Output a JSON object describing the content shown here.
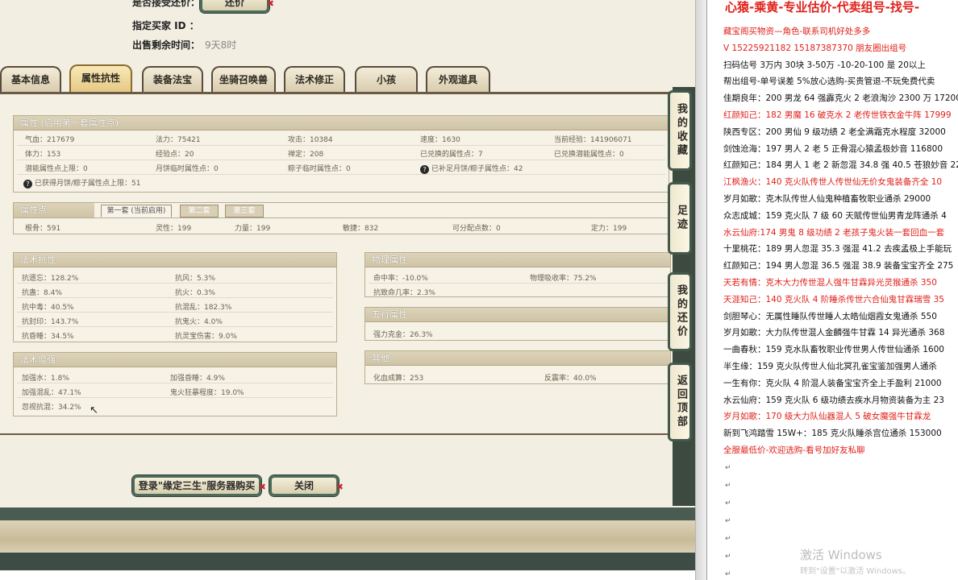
{
  "game": {
    "top": {
      "counter_offer_label": "是否接受还价：",
      "counter_offer_btn": "还价",
      "buyer_id_label": "指定买家 ID ：",
      "time_left_label": "出售剩余时间：",
      "time_left_value": "9天8时"
    },
    "tabs": [
      {
        "label": "基本信息"
      },
      {
        "label": "属性抗性"
      },
      {
        "label": "装备法宝"
      },
      {
        "label": "坐骑召唤兽"
      },
      {
        "label": "法术修正"
      },
      {
        "label": "小孩"
      },
      {
        "label": "外观道具"
      }
    ],
    "attr_panel": {
      "title": "属性 (启用第一套属性点)",
      "rows": [
        [
          "气血：217679",
          "法力：75421",
          "攻击：10384",
          "速度：1630",
          "当前经验：141906071"
        ],
        [
          "体力：153",
          "经验点：20",
          "禅定：208",
          "已兑换的属性点：7",
          "已兑换潜能属性点：0"
        ],
        [
          "潜能属性点上限：0",
          "月饼临时属性点：0",
          "粽子临时属性点：0",
          "已补足月饼/粽子属性点：42",
          ""
        ],
        [
          "已获得月饼/粽子属性点上限：51",
          "",
          "",
          "",
          ""
        ]
      ]
    },
    "points_panel": {
      "title": "属性点",
      "subtabs": [
        "第一套 (当前启用)",
        "第二套",
        "第三套"
      ],
      "values": [
        "根骨：591",
        "灵性：199",
        "力量：199",
        "敏捷：832",
        "可分配点数：0",
        "定力：199"
      ]
    },
    "resist_panel": {
      "title": "法术抗性",
      "left": [
        "抗遗忘：128.2%",
        "抗蛊：8.4%",
        "抗中毒：40.5%",
        "抗封印：143.7%",
        "抗昏睡：34.5%"
      ],
      "right": [
        "抗风：5.3%",
        "抗火：0.3%",
        "抗混乱：182.3%",
        "抗鬼火：4.0%",
        "抗灵宝伤害：9.0%"
      ]
    },
    "boost_panel": {
      "title": "法术增强",
      "left": [
        "加强水：1.8%",
        "加强混乱：47.1%",
        "忽视抗混：34.2%"
      ],
      "right": [
        "加强昏睡：4.9%",
        "鬼火狂暴程度：19.0%",
        ""
      ]
    },
    "physical_panel": {
      "title": "物理属性",
      "left": [
        "命中率：-10.0%",
        "抗致命几率：2.3%"
      ],
      "right": [
        "物理吸收率：75.2%",
        ""
      ]
    },
    "wuxing_panel": {
      "title": "五行属性",
      "left": [
        "强力克金：26.3%"
      ]
    },
    "other_panel": {
      "title": "其他",
      "left": [
        "化血成算：253"
      ],
      "right": [
        "反震率：40.0%"
      ]
    },
    "side_buttons": [
      "我的收藏",
      "足迹",
      "我的还价",
      "返回顶部"
    ],
    "bottom_buttons": {
      "login_buy": "登录\"缘定三生\"服务器购买",
      "close": "关闭"
    }
  },
  "notes": {
    "title": "心猿-乘黄-专业估价-代卖组号-找号-",
    "lines": [
      {
        "text": "藏宝阁买物资—角色-联系司机好处多多",
        "red": true
      },
      {
        "text": "V 15225921182    15187387370 朋友圈出组号",
        "red": true
      },
      {
        "text": "扫码估号 3万内 30块 3-50万 -10-20-100 是 20以上",
        "red": false
      },
      {
        "text": "帮出组号-单号误差 5%放心选购-买贵管退-不玩免费代卖",
        "red": false
      },
      {
        "text": "佳期良年：200 男龙 64 强霹克火 2 老浪淘沙 2300 万 17200",
        "red": false
      },
      {
        "text": "红颜知己：182 男魔 16 破克水 2 老传世铁衣金牛阵 17999",
        "red": true
      },
      {
        "text": "陕西专区：200 男仙 9 级功绩 2 老全满霜克水程度 32000",
        "red": false
      },
      {
        "text": "剑蚀沧海：197 男人 2 老 5 正骨混心猿孟极妙音 116800",
        "red": false
      },
      {
        "text": "红颜知己：184 男人 1 老 2 新忽混 34.8 强 40.5 苍狼妙音 22",
        "red": false
      },
      {
        "text": "江枫渔火：140 克火队传世人传世仙无价女鬼装备齐全 10",
        "red": true
      },
      {
        "text": "岁月如歌：克木队传世人仙鬼种植畜牧职业通杀 29000",
        "red": false
      },
      {
        "text": "众志成城：159 克火队 7 级 60 天赋传世仙男青龙阵通杀 4",
        "red": false
      },
      {
        "text": "水云仙府:174 男鬼 8 级功绩 2 老孩子鬼火装一套回血一套",
        "red": true
      },
      {
        "text": "十里桃花：189 男人忽混 35.3 强混 41.2 去疾孟极上手能玩",
        "red": false
      },
      {
        "text": "红颜知己：194 男人忽混 36.5 强混 38.9 装备宝宝齐全 275",
        "red": false
      },
      {
        "text": "天若有情：克木大力传世混人强牛甘霖异光灵猴通杀 350",
        "red": true
      },
      {
        "text": "天涯知己：140 克火队 4 阶睡杀传世六合仙鬼甘霖瑞雪 35",
        "red": true
      },
      {
        "text": "剑胆琴心：无属性睡队传世睡人太皓仙烟霞女鬼通杀 550",
        "red": false
      },
      {
        "text": "岁月如歌：大力队传世混人金麟强牛甘霖 14 异光通杀 368",
        "red": false
      },
      {
        "text": "一曲春秋：159 克水队畜牧职业传世男人传世仙通杀 1600",
        "red": false
      },
      {
        "text": "半生缘：159 克火队传世人仙北冥孔雀宝鉴加强男人通杀",
        "red": false
      },
      {
        "text": "一生有你：克火队 4 阶混人装备宝宝齐全上手盈利 21000",
        "red": false
      },
      {
        "text": "水云仙府：159 克火队 6 级功绩去疾水月物资装备为主 23",
        "red": false
      },
      {
        "text": "岁月如歌：170 级大力队仙器混人 5 破女魔强牛甘霖龙",
        "red": true
      },
      {
        "text": "新到飞鸿踏雪 15W+：185 克火队睡杀宫位通杀 153000",
        "red": false
      },
      {
        "text": "全服最低价-欢迎选购-看号加好友私聊",
        "red": true
      }
    ],
    "watermark_title": "激活 Windows",
    "watermark_sub": "转到\"设置\"以激活 Windows。"
  }
}
